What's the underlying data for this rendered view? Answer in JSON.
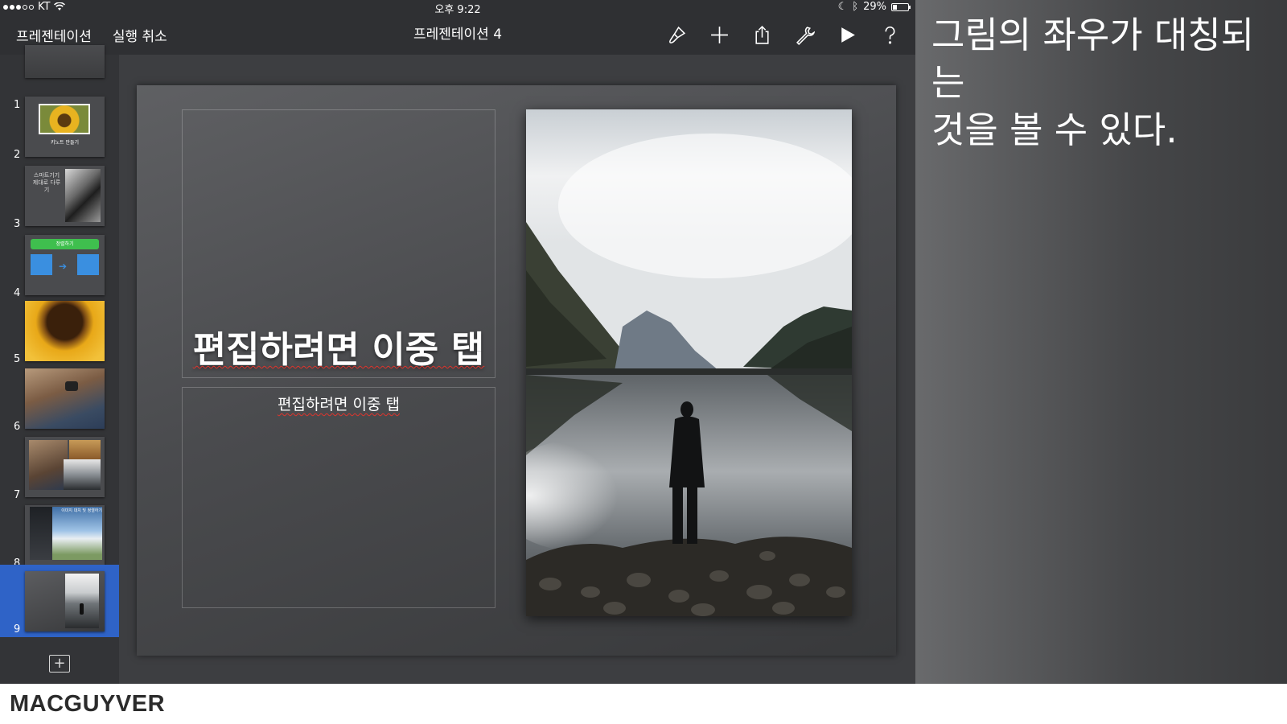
{
  "status_bar": {
    "carrier": "KT",
    "time": "오후 9:22",
    "battery": "29%",
    "battery_level": 0.29,
    "signal_bars": 3,
    "signal_total": 5
  },
  "toolbar": {
    "back_label": "프레젠테이션",
    "undo_label": "실행 취소",
    "title": "프레젠테이션 4",
    "icons": [
      "format-brush-icon",
      "plus-icon",
      "share-icon",
      "wrench-icon",
      "play-icon",
      "help-icon"
    ]
  },
  "navigator": {
    "slides": [
      {
        "number": "1",
        "caption": ""
      },
      {
        "number": "2",
        "caption": "키노트 만들기"
      },
      {
        "number": "3",
        "caption": "스마트기기 제대로 다루기"
      },
      {
        "number": "4",
        "caption": "정렬하기"
      },
      {
        "number": "5",
        "caption": ""
      },
      {
        "number": "6",
        "caption": ""
      },
      {
        "number": "7",
        "caption": ""
      },
      {
        "number": "8",
        "caption": "이미지 대치 및 정렬하기"
      },
      {
        "number": "9",
        "caption": ""
      }
    ],
    "selected_index": 9
  },
  "slide": {
    "title_placeholder": "편집하려면 이중 탭",
    "body_placeholder": "편집하려면 이중 탭"
  },
  "caption": {
    "line1": "그림의 좌우가 대칭되는",
    "line2": "것을 볼 수 있다."
  },
  "brand": "MACGUYVER",
  "colors": {
    "toolbar_bg": "#2f3033",
    "navigator_bg": "#333437",
    "selection": "#2f63c7",
    "canvas_bg": "#3d3e41"
  }
}
